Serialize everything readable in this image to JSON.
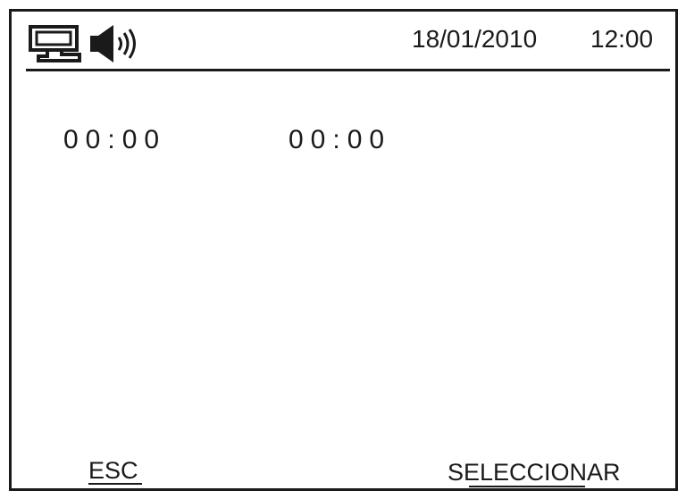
{
  "status_bar": {
    "date": "18/01/2010",
    "time": "12:00",
    "icons": [
      "network-icon",
      "speaker-icon"
    ]
  },
  "timers": {
    "first": "00:00",
    "second": "00:00"
  },
  "softkeys": {
    "left_label": "ESC",
    "right_label": "SELECCIONAR"
  },
  "colors": {
    "foreground": "#1a1a1a",
    "background": "#ffffff"
  }
}
